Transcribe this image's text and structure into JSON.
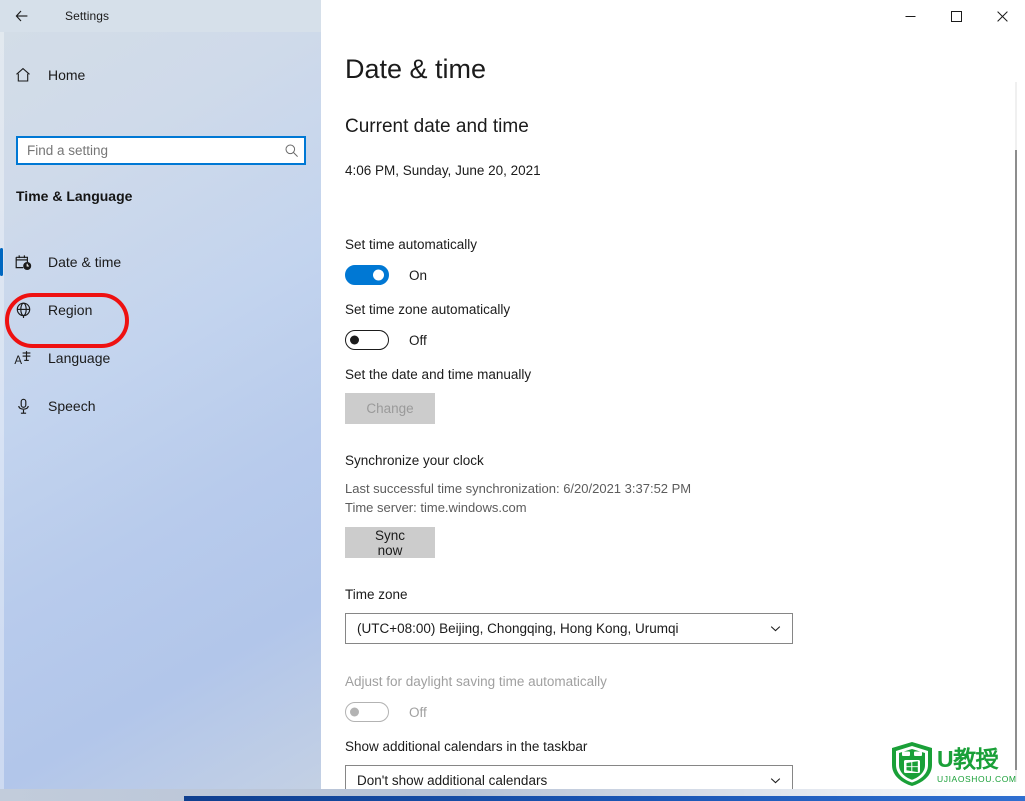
{
  "window": {
    "title": "Settings",
    "back_icon": "back-arrow-icon",
    "controls": {
      "minimize": "minimize-icon",
      "maximize": "maximize-icon",
      "close": "close-icon"
    }
  },
  "sidebar": {
    "home_label": "Home",
    "home_icon": "home-icon",
    "search": {
      "placeholder": "Find a setting",
      "value": "",
      "icon": "search-icon"
    },
    "section_title": "Time & Language",
    "items": [
      {
        "label": "Date & time",
        "icon": "calendar-clock-icon",
        "selected": true
      },
      {
        "label": "Region",
        "icon": "globe-icon",
        "selected": false
      },
      {
        "label": "Language",
        "icon": "language-icon",
        "selected": false
      },
      {
        "label": "Speech",
        "icon": "microphone-icon",
        "selected": false
      }
    ],
    "highlight": {
      "target": "Language",
      "color": "#ee1111"
    }
  },
  "main": {
    "page_title": "Date & time",
    "current": {
      "heading": "Current date and time",
      "value": "4:06 PM, Sunday, June 20, 2021"
    },
    "set_time_auto": {
      "label": "Set time automatically",
      "state": "On",
      "on": true,
      "disabled": false
    },
    "set_timezone_auto": {
      "label": "Set time zone automatically",
      "state": "Off",
      "on": false,
      "disabled": false
    },
    "manual": {
      "label": "Set the date and time manually",
      "button": "Change",
      "disabled": true
    },
    "sync": {
      "heading": "Synchronize your clock",
      "last_sync": "Last successful time synchronization: 6/20/2021 3:37:52 PM",
      "server": "Time server: time.windows.com",
      "button": "Sync now"
    },
    "timezone": {
      "label": "Time zone",
      "value": "(UTC+08:00) Beijing, Chongqing, Hong Kong, Urumqi",
      "chevron": "chevron-down-icon"
    },
    "dst": {
      "label": "Adjust for daylight saving time automatically",
      "state": "Off",
      "on": false,
      "disabled": true
    },
    "calendars": {
      "label": "Show additional calendars in the taskbar",
      "value": "Don't show additional calendars",
      "chevron": "chevron-down-icon"
    }
  },
  "watermark": {
    "main": "U教授",
    "sub": "UJIAOSHOU.COM",
    "logo_icon": "shield-windows-logo-icon",
    "color": "#1aa038"
  },
  "theme": {
    "accent": "#0078d4",
    "selected_bar": "#0067c0",
    "highlight": "#ee1111"
  }
}
